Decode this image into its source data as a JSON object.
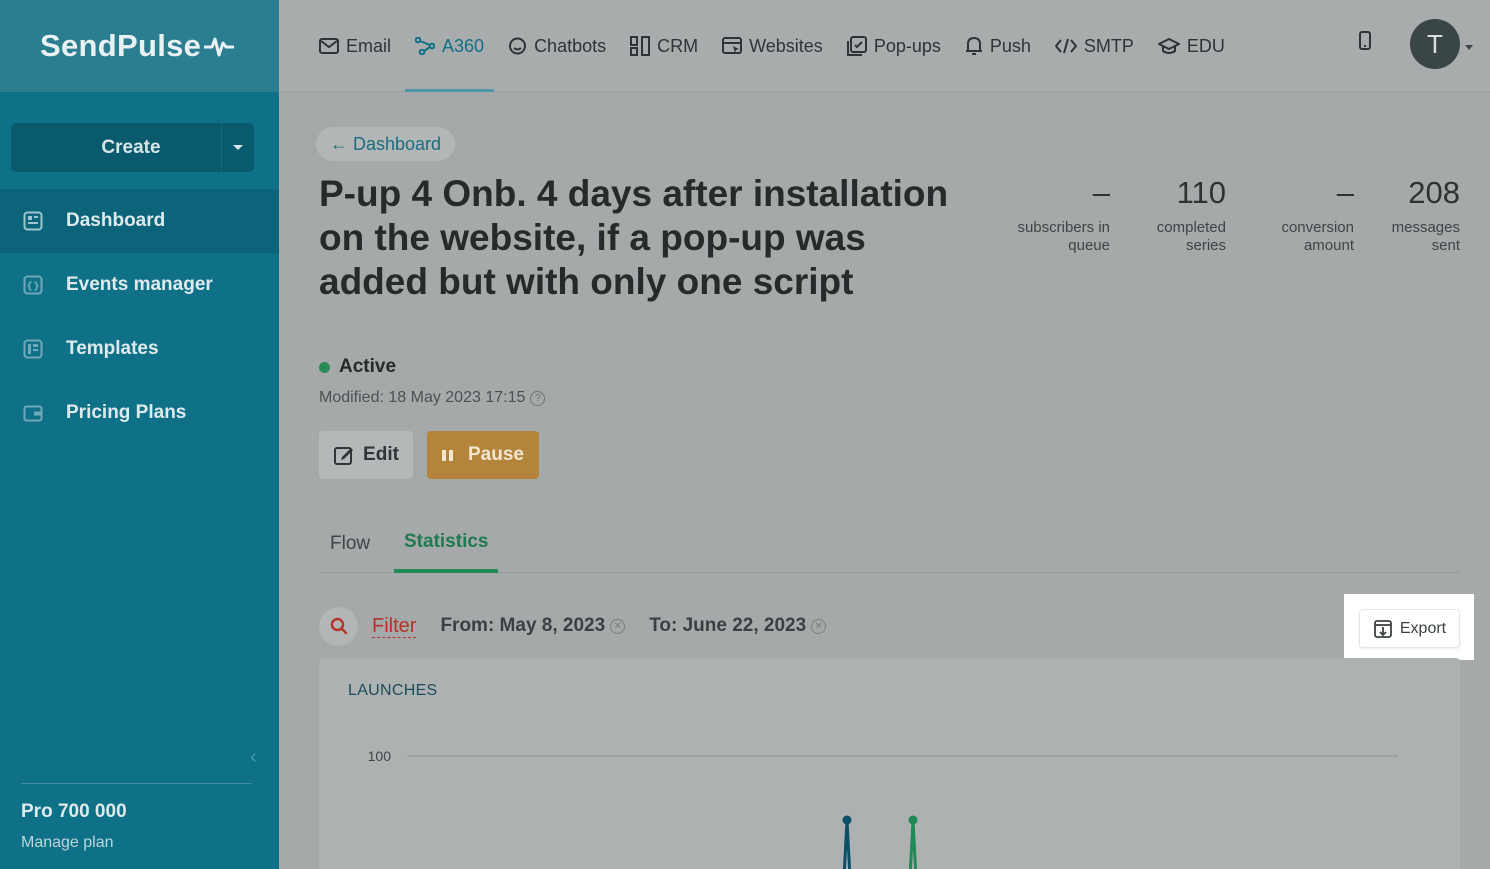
{
  "sidebar": {
    "logo": "SendPulse",
    "create_label": "Create",
    "items": [
      {
        "label": "Dashboard",
        "icon": "dashboard-icon",
        "active": true
      },
      {
        "label": "Events manager",
        "icon": "events-icon",
        "active": false
      },
      {
        "label": "Templates",
        "icon": "templates-icon",
        "active": false
      },
      {
        "label": "Pricing Plans",
        "icon": "wallet-icon",
        "active": false
      }
    ],
    "plan_name": "Pro 700 000",
    "manage_plan": "Manage plan"
  },
  "topnav": {
    "items": [
      {
        "label": "Email",
        "icon": "mail-icon"
      },
      {
        "label": "A360",
        "icon": "automation-icon",
        "active": true
      },
      {
        "label": "Chatbots",
        "icon": "chat-icon"
      },
      {
        "label": "CRM",
        "icon": "crm-icon"
      },
      {
        "label": "Websites",
        "icon": "website-icon"
      },
      {
        "label": "Pop-ups",
        "icon": "popup-icon"
      },
      {
        "label": "Push",
        "icon": "bell-icon"
      },
      {
        "label": "SMTP",
        "icon": "code-icon"
      },
      {
        "label": "EDU",
        "icon": "graduation-icon"
      }
    ],
    "avatar_letter": "T"
  },
  "page": {
    "back_label": "← Dashboard",
    "title": "P-up 4 Onb. 4 days after installation on the website, if a pop-up was added but with only one script",
    "status": "Active",
    "modified": "Modified: 18 May 2023 17:15",
    "edit_label": "Edit",
    "pause_label": "Pause"
  },
  "stats": [
    {
      "value": "–",
      "label_line1": "subscribers in",
      "label_line2": "queue"
    },
    {
      "value": "110",
      "label_line1": "completed",
      "label_line2": "series"
    },
    {
      "value": "–",
      "label_line1": "conversion",
      "label_line2": "amount"
    },
    {
      "value": "208",
      "label_line1": "messages",
      "label_line2": "sent"
    }
  ],
  "tabs": [
    {
      "label": "Flow",
      "active": false
    },
    {
      "label": "Statistics",
      "active": true
    }
  ],
  "filter": {
    "filter_label": "Filter",
    "from": "From: May 8, 2023",
    "to": "To: June 22, 2023",
    "export_label": "Export"
  },
  "chart_data": {
    "type": "line",
    "title": "LAUNCHES",
    "y_tick_labels": [
      "100"
    ],
    "ylim": [
      0,
      100
    ],
    "series": [
      {
        "color": "#0d4f66",
        "peak_date_index": 11,
        "values_note": "spike"
      },
      {
        "color": "#1f8a56",
        "peak_date_index": 12,
        "values_note": "spike"
      }
    ],
    "colors": {
      "series_1": "#0d4f66",
      "series_2": "#1f8a56"
    }
  }
}
